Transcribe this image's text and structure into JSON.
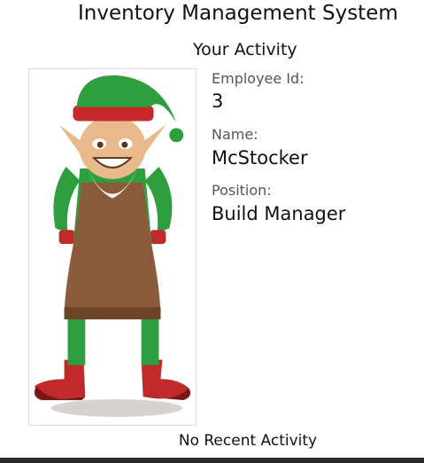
{
  "header": {
    "app_title": "Inventory Management System",
    "section_title": "Your Activity"
  },
  "profile": {
    "avatar_icon": "elf-employee-avatar-icon",
    "employee_id_label": "Employee Id:",
    "employee_id": "3",
    "name_label": "Name:",
    "name": "McStocker",
    "position_label": "Position:",
    "position": "Build Manager"
  },
  "activity": {
    "empty_message": "No Recent Activity"
  },
  "colors": {
    "elf_green": "#2e9e3e",
    "hat_band_red": "#c6282b",
    "apron_brown": "#8a5a3b",
    "boot_red": "#c02a2a",
    "skin": "#e9b98c"
  }
}
